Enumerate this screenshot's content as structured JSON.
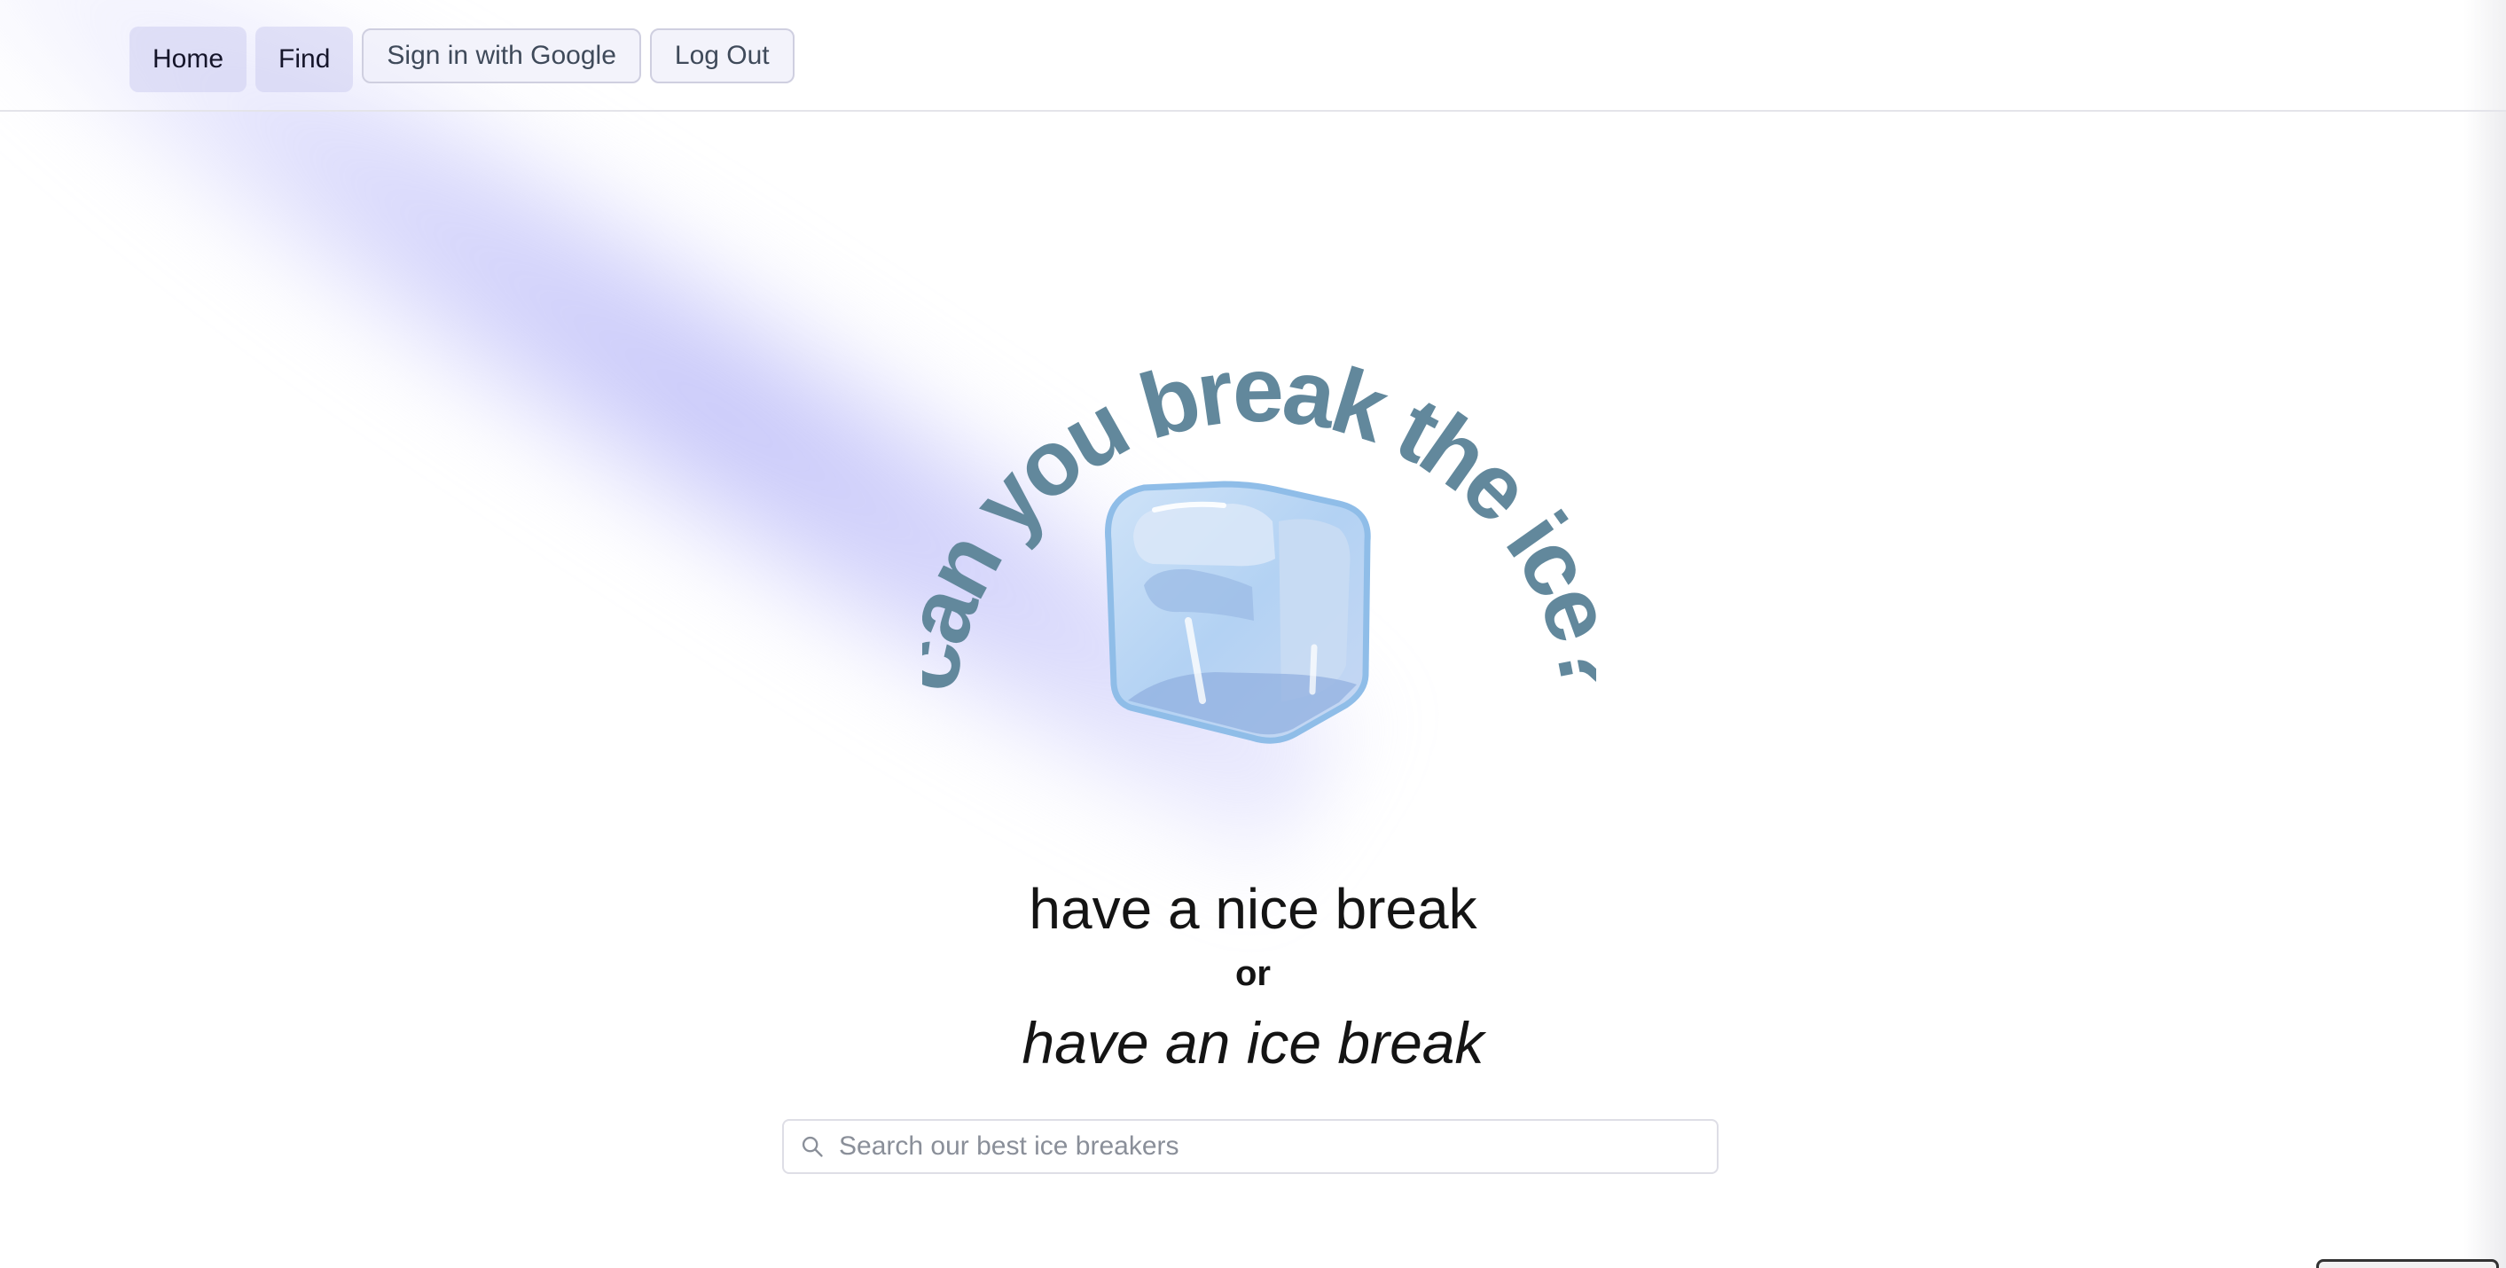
{
  "nav": {
    "home_label": "Home",
    "find_label": "Find",
    "signin_label": "Sign in with Google",
    "logout_label": "Log Out"
  },
  "logo": {
    "arc_text": "can you break the ice?",
    "text_color": "#62889c",
    "ice_color": "#b3d2f3"
  },
  "hero": {
    "line1": "have a nice break",
    "line2": "or",
    "line3": "have an ice break"
  },
  "search": {
    "placeholder": "Search our best ice breakers",
    "icon": "search-icon"
  },
  "colors": {
    "glow": "#b5b5f5",
    "text": "#141414"
  }
}
